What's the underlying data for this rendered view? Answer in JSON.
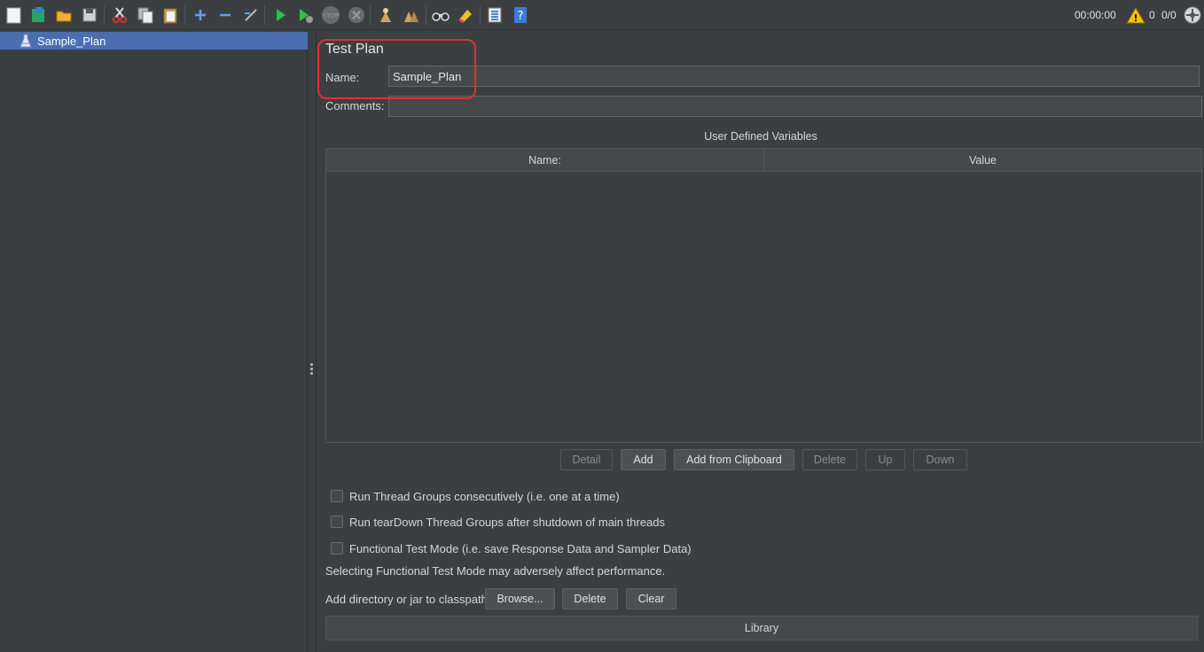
{
  "toolbar": {
    "icons": [
      "new-icon",
      "templates-icon",
      "open-icon",
      "save-icon",
      "cut-icon",
      "copy-icon",
      "paste-icon",
      "expand-icon",
      "collapse-icon",
      "toggle-icon",
      "start-icon",
      "start-no-pauses-icon",
      "stop-icon",
      "shutdown-icon",
      "clear-icon",
      "clear-all-icon",
      "search-icon",
      "reset-search-icon",
      "function-helper-icon",
      "help-icon"
    ],
    "timer": "00:00:00",
    "warning_count": "0",
    "threads": "0/0"
  },
  "tree": {
    "items": [
      {
        "label": "Sample_Plan"
      }
    ]
  },
  "panel": {
    "title": "Test Plan",
    "name_label": "Name:",
    "name_value": "Sample_Plan",
    "comments_label": "Comments:",
    "comments_value": "",
    "udv": {
      "title": "User Defined Variables",
      "columns": [
        "Name:",
        "Value"
      ]
    },
    "buttons": {
      "detail": "Detail",
      "add": "Add",
      "add_clipboard": "Add from Clipboard",
      "delete": "Delete",
      "up": "Up",
      "down": "Down"
    },
    "checkboxes": [
      {
        "label": "Run Thread Groups consecutively (i.e. one at a time)",
        "checked": false
      },
      {
        "label": "Run tearDown Thread Groups after shutdown of main threads",
        "checked": false
      },
      {
        "label": "Functional Test Mode (i.e. save Response Data and Sampler Data)",
        "checked": false
      }
    ],
    "functional_note": "Selecting Functional Test Mode may adversely affect performance.",
    "classpath": {
      "label": "Add directory or jar to classpath",
      "browse": "Browse...",
      "delete": "Delete",
      "clear": "Clear",
      "library_header": "Library"
    }
  },
  "colors": {
    "background": "#3c3f41",
    "selection": "#4b6eaf",
    "highlight_ring": "#e03030"
  }
}
